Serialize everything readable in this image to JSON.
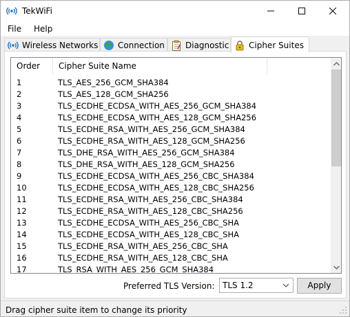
{
  "window": {
    "title": "TekWiFi",
    "controls": {
      "minimize": "minimize",
      "maximize": "maximize",
      "close": "close"
    }
  },
  "menu": {
    "file": "File",
    "help": "Help"
  },
  "tabs": [
    {
      "label": "Wireless Networks",
      "icon": "wifi-icon"
    },
    {
      "label": "Connection",
      "icon": "globe-icon"
    },
    {
      "label": "Diagnostic",
      "icon": "clipboard-icon"
    },
    {
      "label": "Cipher Suites",
      "icon": "lock-icon",
      "selected": true
    }
  ],
  "cipher_list": {
    "columns": {
      "order": "Order",
      "name": "Cipher Suite Name"
    },
    "rows": [
      {
        "order": "1",
        "name": "TLS_AES_256_GCM_SHA384"
      },
      {
        "order": "2",
        "name": "TLS_AES_128_GCM_SHA256"
      },
      {
        "order": "3",
        "name": "TLS_ECDHE_ECDSA_WITH_AES_256_GCM_SHA384"
      },
      {
        "order": "4",
        "name": "TLS_ECDHE_ECDSA_WITH_AES_128_GCM_SHA256"
      },
      {
        "order": "5",
        "name": "TLS_ECDHE_RSA_WITH_AES_256_GCM_SHA384"
      },
      {
        "order": "6",
        "name": "TLS_ECDHE_RSA_WITH_AES_128_GCM_SHA256"
      },
      {
        "order": "7",
        "name": "TLS_DHE_RSA_WITH_AES_256_GCM_SHA384"
      },
      {
        "order": "8",
        "name": "TLS_DHE_RSA_WITH_AES_128_GCM_SHA256"
      },
      {
        "order": "9",
        "name": "TLS_ECDHE_ECDSA_WITH_AES_256_CBC_SHA384"
      },
      {
        "order": "10",
        "name": "TLS_ECDHE_ECDSA_WITH_AES_128_CBC_SHA256"
      },
      {
        "order": "11",
        "name": "TLS_ECDHE_RSA_WITH_AES_256_CBC_SHA384"
      },
      {
        "order": "12",
        "name": "TLS_ECDHE_RSA_WITH_AES_128_CBC_SHA256"
      },
      {
        "order": "13",
        "name": "TLS_ECDHE_ECDSA_WITH_AES_256_CBC_SHA"
      },
      {
        "order": "14",
        "name": "TLS_ECDHE_ECDSA_WITH_AES_128_CBC_SHA"
      },
      {
        "order": "15",
        "name": "TLS_ECDHE_RSA_WITH_AES_256_CBC_SHA"
      },
      {
        "order": "16",
        "name": "TLS_ECDHE_RSA_WITH_AES_128_CBC_SHA"
      },
      {
        "order": "17",
        "name": "TLS_RSA_WITH_AES_256_GCM_SHA384"
      }
    ]
  },
  "tls": {
    "label": "Preferred TLS Version:",
    "selected": "TLS 1.2"
  },
  "apply_label": "Apply",
  "status": "Drag cipher suite item to change its priority",
  "colors": {
    "accent_wifi": "#1a73c9",
    "lock": "#d4a017",
    "scroll_thumb": "#cdcdcd"
  }
}
